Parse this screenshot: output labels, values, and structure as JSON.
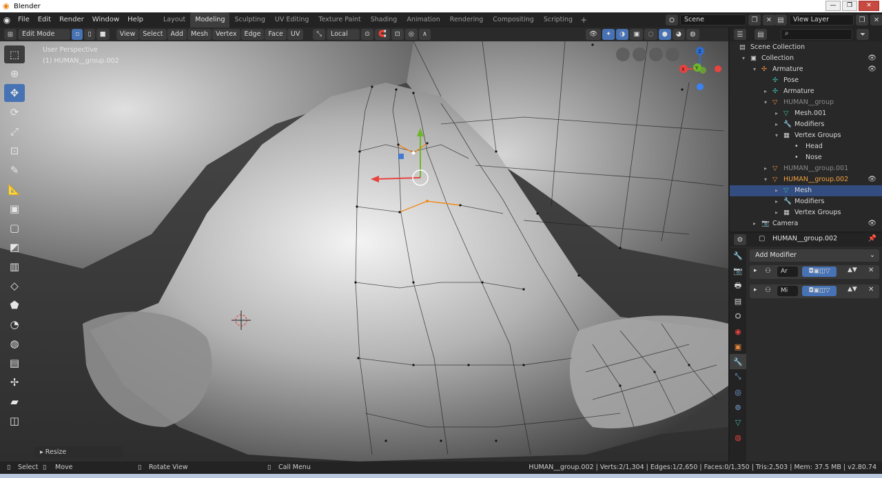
{
  "window": {
    "title": "Blender"
  },
  "menus": [
    "File",
    "Edit",
    "Render",
    "Window",
    "Help"
  ],
  "workspaces": [
    {
      "label": "Layout",
      "active": false
    },
    {
      "label": "Modeling",
      "active": true
    },
    {
      "label": "Sculpting",
      "active": false
    },
    {
      "label": "UV Editing",
      "active": false
    },
    {
      "label": "Texture Paint",
      "active": false
    },
    {
      "label": "Shading",
      "active": false
    },
    {
      "label": "Animation",
      "active": false
    },
    {
      "label": "Rendering",
      "active": false
    },
    {
      "label": "Compositing",
      "active": false
    },
    {
      "label": "Scripting",
      "active": false
    }
  ],
  "scene": {
    "name": "Scene"
  },
  "view_layer": {
    "name": "View Layer"
  },
  "viewport_header": {
    "mode": "Edit Mode",
    "menus": [
      "View",
      "Select",
      "Add",
      "Mesh",
      "Vertex",
      "Edge",
      "Face",
      "UV"
    ],
    "orientation": "Local"
  },
  "viewport": {
    "perspective_label": "User Perspective",
    "object_label": "(1) HUMAN__group.002",
    "last_operator": "Resize",
    "gizmo_axes": [
      "Z",
      "Y",
      "X"
    ]
  },
  "outliner": {
    "search_placeholder": "",
    "rows": [
      {
        "label": "Scene Collection",
        "indent": 0,
        "icon": "scene-collection-icon",
        "icon_glyph": "▤",
        "icon_color": "#cfcfcf",
        "dim": false
      },
      {
        "label": "Collection",
        "indent": 1,
        "icon": "collection-icon",
        "icon_glyph": "▣",
        "icon_color": "#cfcfcf",
        "dim": false,
        "eye": true,
        "expanded": true
      },
      {
        "label": "Armature",
        "indent": 2,
        "icon": "armature-icon",
        "icon_glyph": "✣",
        "icon_color": "#e8893a",
        "dim": false,
        "eye": true,
        "expanded": true
      },
      {
        "label": "Pose",
        "indent": 3,
        "icon": "pose-icon",
        "icon_glyph": "✣",
        "icon_color": "#3fb8a6",
        "dim": false
      },
      {
        "label": "Armature",
        "indent": 3,
        "icon": "armature-data-icon",
        "icon_glyph": "✣",
        "icon_color": "#3fb8a6",
        "dim": false,
        "expandable": true
      },
      {
        "label": "HUMAN__group",
        "indent": 3,
        "icon": "mesh-object-icon",
        "icon_glyph": "▽",
        "icon_color": "#e8893a",
        "dim": true,
        "expanded": true
      },
      {
        "label": "Mesh.001",
        "indent": 4,
        "icon": "mesh-data-icon",
        "icon_glyph": "▽",
        "icon_color": "#3fb8a6",
        "dim": false,
        "expandable": true
      },
      {
        "label": "Modifiers",
        "indent": 4,
        "icon": "wrench-icon",
        "icon_glyph": "🔧",
        "icon_color": "#7fb0e8",
        "dim": false,
        "expandable": true
      },
      {
        "label": "Vertex Groups",
        "indent": 4,
        "icon": "vertex-groups-icon",
        "icon_glyph": "▦",
        "icon_color": "#cfcfcf",
        "dim": false,
        "expanded": true
      },
      {
        "label": "Head",
        "indent": 5,
        "icon": "dot-icon",
        "icon_glyph": "•",
        "icon_color": "#cfcfcf",
        "dim": false
      },
      {
        "label": "Nose",
        "indent": 5,
        "icon": "dot-icon",
        "icon_glyph": "•",
        "icon_color": "#cfcfcf",
        "dim": false
      },
      {
        "label": "HUMAN__group.001",
        "indent": 3,
        "icon": "mesh-object-icon",
        "icon_glyph": "▽",
        "icon_color": "#e8893a",
        "dim": true,
        "expandable": true
      },
      {
        "label": "HUMAN__group.002",
        "indent": 3,
        "icon": "mesh-object-icon",
        "icon_glyph": "▽",
        "icon_color": "#e8893a",
        "dim": false,
        "active_obj": true,
        "eye": true,
        "expanded": true
      },
      {
        "label": "Mesh",
        "indent": 4,
        "icon": "mesh-data-icon",
        "icon_glyph": "▽",
        "icon_color": "#3fb8a6",
        "dim": false,
        "selected": true,
        "expandable": true
      },
      {
        "label": "Modifiers",
        "indent": 4,
        "icon": "wrench-icon",
        "icon_glyph": "🔧",
        "icon_color": "#7fb0e8",
        "dim": false,
        "expandable": true
      },
      {
        "label": "Vertex Groups",
        "indent": 4,
        "icon": "vertex-groups-icon",
        "icon_glyph": "▦",
        "icon_color": "#cfcfcf",
        "dim": false,
        "expandable": true
      },
      {
        "label": "Camera",
        "indent": 2,
        "icon": "camera-icon",
        "icon_glyph": "📷",
        "icon_color": "#e8893a",
        "dim": false,
        "eye": true,
        "expandable": true
      }
    ]
  },
  "properties": {
    "object_name": "HUMAN__group.002",
    "add_modifier_label": "Add Modifier",
    "modifiers": [
      {
        "name": "Ar",
        "icon": "armature-modifier-icon"
      },
      {
        "name": "Mi",
        "icon": "mirror-modifier-icon"
      }
    ]
  },
  "statusbar": {
    "select": "Select",
    "move": "Move",
    "rotate": "Rotate View",
    "call_menu": "Call Menu",
    "stats": "HUMAN__group.002 | Verts:2/1,304 | Edges:1/2,650 | Faces:0/1,350 | Tris:2,503 | Mem: 37.5 MB | v2.80.74"
  },
  "colors": {
    "accent": "#4772b3",
    "selection": "#334d80",
    "object_orange": "#e8893a",
    "data_teal": "#3fb8a6",
    "axis_x": "#e8433f",
    "axis_y": "#6fb52a",
    "axis_z": "#2f6ed1"
  }
}
